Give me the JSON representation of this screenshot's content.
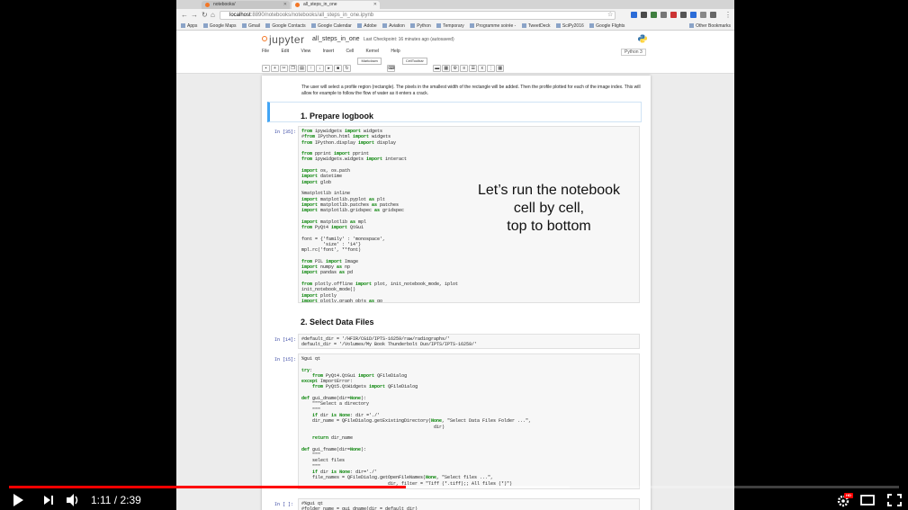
{
  "browser": {
    "tabs": [
      {
        "title": "notebooks/"
      },
      {
        "title": "all_steps_in_one"
      }
    ],
    "url_host": "localhost",
    "url_path": ":8890/notebooks/notebooks/all_steps_in_one.ipynb",
    "bookmarks": [
      "Apps",
      "Google Maps",
      "Gmail",
      "Google Contacts",
      "Google Calendar",
      "Adobe",
      "Aviation",
      "Python",
      "Temporary",
      "Programme soirée -",
      "TweetDeck",
      "SciPy2016",
      "Google Flights"
    ],
    "other_bookmarks": "Other Bookmarks"
  },
  "jupyter": {
    "logo": "jupyter",
    "notebook_name": "all_steps_in_one",
    "checkpoint": "Last Checkpoint: 16 minutes ago (autosaved)",
    "menu": [
      "File",
      "Edit",
      "View",
      "Insert",
      "Cell",
      "Kernel",
      "Help"
    ],
    "kernel": "Python 3",
    "cell_type": "Markdown",
    "celltoolbar": "CellToolbar"
  },
  "notebook": {
    "intro": "The user will select a profile region (rectangle). The pixels in the smallest width of the rectangle will be added. Then the profile plotted for each of the image index. This will allow for example to follow the flow of water as it enters a crack.",
    "heading1": "1. Prepare logbook",
    "heading2": "2. Select Data Files",
    "cells": [
      {
        "prompt": "In [35]:",
        "code": "from ipywidgets import widgets\n#from IPython.html import widgets\nfrom IPython.display import display\n\nfrom pprint import pprint\nfrom ipywidgets.widgets import interact\n\nimport os, os.path\nimport datetime\nimport glob\n\n%matplotlib inline\nimport matplotlib.pyplot as plt\nimport matplotlib.patches as patches\nimport matplotlib.gridspec as gridspec\n\nimport matplotlib as mpl\nfrom PyQt4 import QtGui\n\nfont = {'family' : 'monospace',\n        'size' : '14'}\nmpl.rc('font', **font)\n\nfrom PIL import Image\nimport numpy as np\nimport pandas as pd\n\nfrom plotly.offline import plot, init_notebook_mode, iplot\ninit_notebook_mode()\nimport plotly\nimport plotly.graph_objs as go"
      },
      {
        "prompt": "In [14]:",
        "code": "#default_dir = '/HFIR/CG1D/IPTS-16259/raw/radiographs/'\ndefault_dir = '/Volumes/My Book Thunderbolt Duo/IPTS/IPTS-16259/'"
      },
      {
        "prompt": "In [15]:",
        "code": "%gui qt\n\ntry:\n    from PyQt4.QtGui import QFileDialog\nexcept ImportError:\n    from PyQt5.QtWidgets import QFileDialog\n\ndef gui_dname(dir=None):\n    \"\"\"Select a directory\n    \"\"\"\n    if dir is None: dir ='./'\n    dir_name = QFileDialog.getExistingDirectory(None, \"Select Data Files Folder ...\",\n                                                 dir)\n\n    return dir_name\n\ndef gui_fname(dir=None):\n    \"\"\"\n    select files\n    \"\"\"\n    if dir is None: dir='./'\n    file_names = QFileDialog.getOpenFileNames(None, \"Select files ...\",\n                                dir, filter = \"Tiff (*.tiff);; All files (*)\")\n    return file_names"
      },
      {
        "prompt": "In [ ]:",
        "code": "#%gui qt\n#folder_name = gui_dname(dir = default_dir)"
      }
    ]
  },
  "overlay": {
    "text": "Let’s run the notebook\ncell by cell,\ntop to bottom"
  },
  "player": {
    "current_time": "1:11",
    "duration": "2:39",
    "time_display": "1:11 / 2:39",
    "played_fraction": 0.446,
    "buffered_fraction": 0.63,
    "hd_badge": "HD"
  }
}
